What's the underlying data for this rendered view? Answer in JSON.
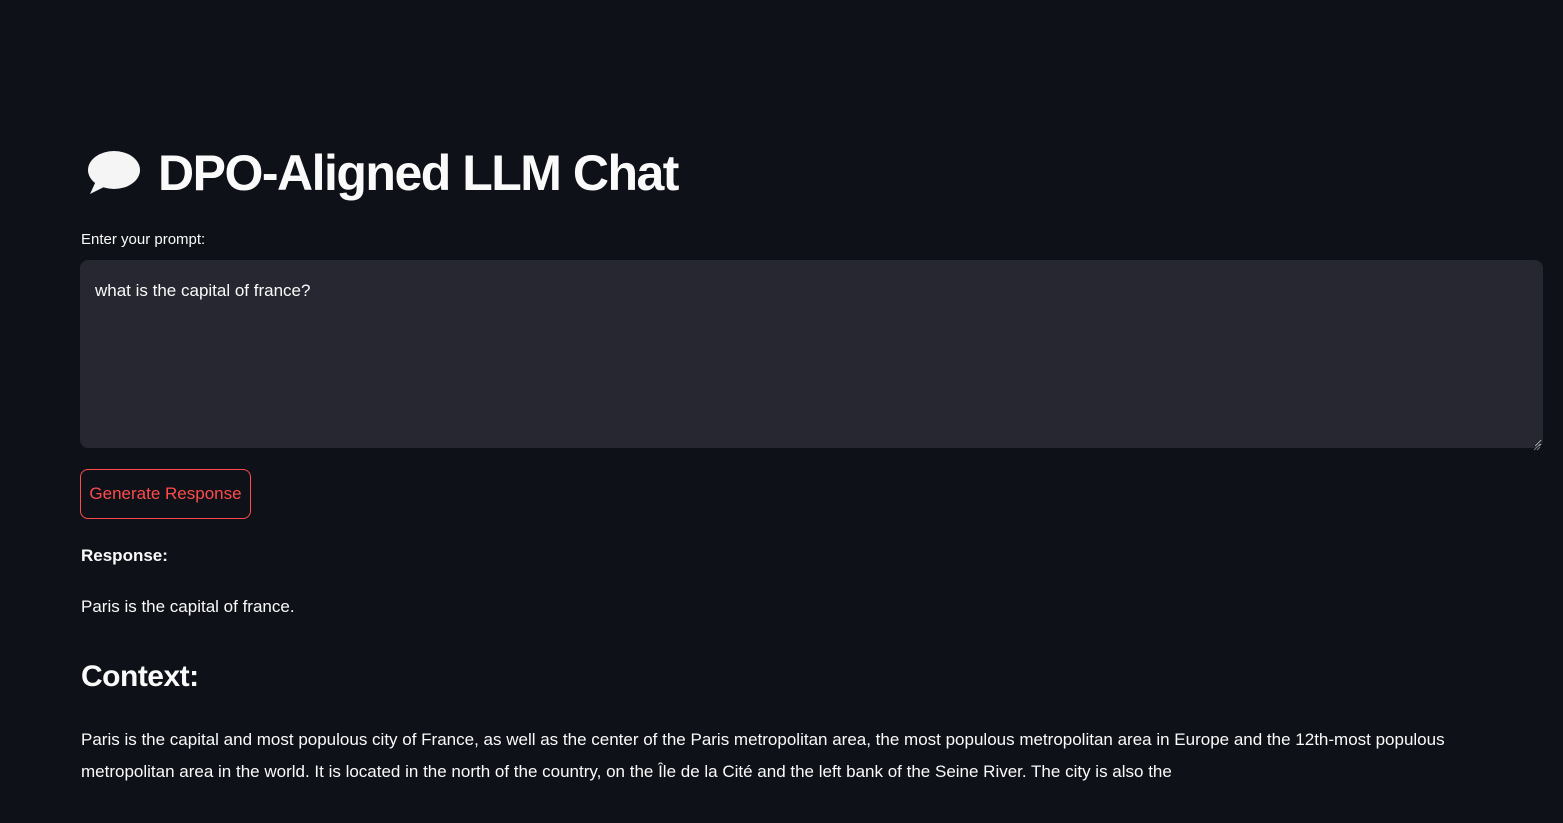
{
  "app": {
    "title": "DPO-Aligned LLM Chat",
    "title_icon": "speech-balloon-icon"
  },
  "prompt": {
    "label": "Enter your prompt:",
    "value": "what is the capital of france?"
  },
  "actions": {
    "generate_label": "Generate Response"
  },
  "response": {
    "label": "Response:",
    "text": "Paris is the capital of france."
  },
  "context": {
    "heading": "Context:",
    "text": "Paris is the capital and most populous city of France, as well as the center of the Paris metropolitan area, the most populous metropolitan area in Europe and the 12th-most populous metropolitan area in the world. It is located in the north of the country, on the Île de la Cité and the left bank of the Seine River. The city is also the"
  },
  "colors": {
    "background": "#0e1117",
    "input_background": "#262730",
    "accent": "#ff4b4b",
    "text": "#fafafa"
  }
}
